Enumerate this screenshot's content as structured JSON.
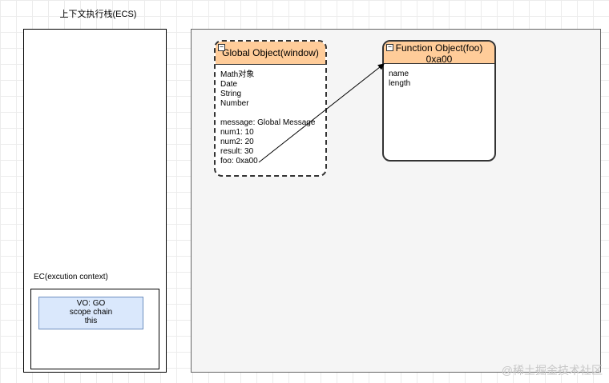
{
  "ecs": {
    "title": "上下文执行栈(ECS)"
  },
  "ec": {
    "title": "EC(excution context)",
    "vo_lines": [
      "VO: GO",
      "scope chain",
      "this"
    ]
  },
  "global_object": {
    "title": "Global Object(window)",
    "properties": [
      "Math对象",
      "Date",
      "String",
      "Number",
      "",
      "message: Global Message",
      "num1: 10",
      "num2: 20",
      "result: 30",
      "foo: 0xa00"
    ]
  },
  "function_object": {
    "title_line1": "Function Object(foo)",
    "title_line2": "0xa00",
    "properties": [
      "name",
      "length"
    ]
  },
  "watermark": "@稀土掘金技术社区",
  "colors": {
    "header_fill": "#ffcc99",
    "vo_fill": "#dae8fc",
    "vo_border": "#6c8ebf",
    "heap_fill": "#f5f5f5"
  }
}
